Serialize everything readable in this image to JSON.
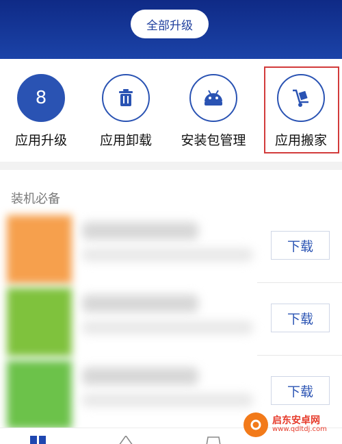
{
  "header": {
    "upgrade_all_label": "全部升级"
  },
  "tools": [
    {
      "label": "应用升级",
      "badge": "8",
      "icon": "badge-count"
    },
    {
      "label": "应用卸载",
      "icon": "trash-icon"
    },
    {
      "label": "安装包管理",
      "icon": "android-icon"
    },
    {
      "label": "应用搬家",
      "icon": "hand-truck-icon"
    }
  ],
  "section": {
    "title": "装机必备"
  },
  "apps": [
    {
      "download_label": "下载",
      "icon_color": "#f6a04d"
    },
    {
      "download_label": "下载",
      "icon_color": "#7fc23d"
    },
    {
      "download_label": "下载",
      "icon_color": "#6cc24a"
    }
  ],
  "bottom_nav": [
    {
      "icon": "grid-icon"
    },
    {
      "icon": "star-icon"
    },
    {
      "icon": "gamepad-icon"
    }
  ],
  "watermark": {
    "cn": "启东安卓网",
    "en": "www.qdltdj.com"
  },
  "colors": {
    "primary": "#2a53b3",
    "header": "#1b43a8",
    "highlight": "#d23a3a"
  }
}
